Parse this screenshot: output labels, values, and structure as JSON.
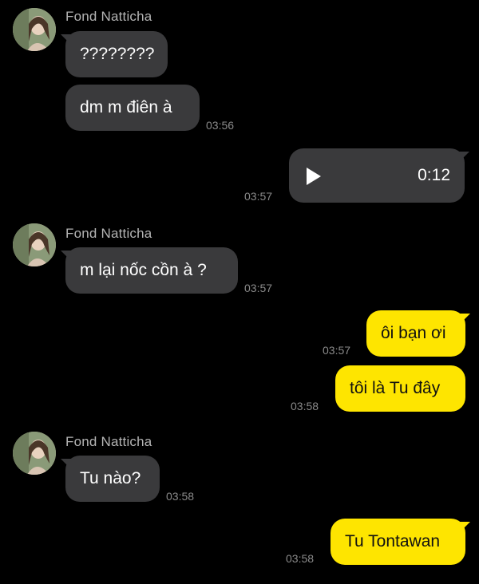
{
  "colors": {
    "background": "#000000",
    "incoming_bubble": "#3a3a3c",
    "outgoing_bubble": "#fee500",
    "sender_name": "#b4b4b4",
    "timestamp": "#8a8a8a"
  },
  "groups": [
    {
      "sender": "Fond Natticha",
      "avatar_icon": "profile-photo",
      "messages": [
        {
          "text": "????????"
        },
        {
          "text": "dm m điên à",
          "time": "03:56"
        }
      ]
    },
    {
      "direction": "out",
      "voice_message": {
        "icon": "play-icon",
        "duration": "0:12",
        "time": "03:57"
      }
    },
    {
      "sender": "Fond Natticha",
      "avatar_icon": "profile-photo",
      "messages": [
        {
          "text": "m lại nốc cồn à ?",
          "time": "03:57"
        }
      ]
    },
    {
      "direction": "out",
      "messages": [
        {
          "text": "ôi bạn ơi",
          "time": "03:57"
        },
        {
          "text": "tôi là Tu đây",
          "time": "03:58"
        }
      ]
    },
    {
      "sender": "Fond Natticha",
      "avatar_icon": "profile-photo",
      "messages": [
        {
          "text": "Tu nào?",
          "time": "03:58"
        }
      ]
    },
    {
      "direction": "out",
      "messages": [
        {
          "text": "Tu Tontawan",
          "time": "03:58"
        }
      ]
    }
  ]
}
